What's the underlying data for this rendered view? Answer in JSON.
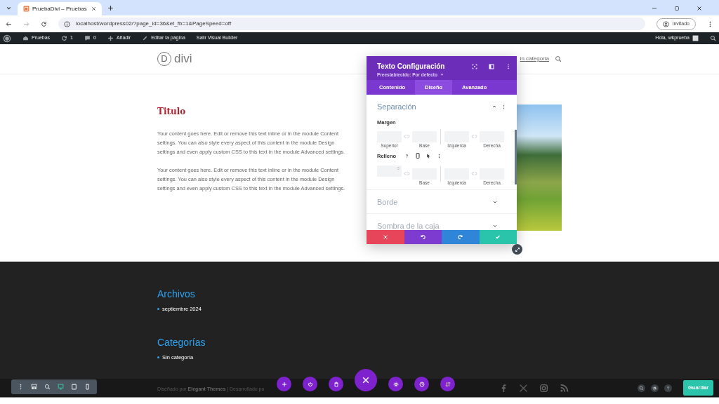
{
  "browser": {
    "tab_title": "PruebaDivi – Pruebas",
    "url": "localhost/wordpress02/?page_id=36&et_fb=1&PageSpeed=off",
    "profile": "Invitado"
  },
  "admin_bar": {
    "items": [
      {
        "kind": "site",
        "label": "Pruebas"
      },
      {
        "kind": "updates",
        "label": "1"
      },
      {
        "kind": "comments",
        "label": "0"
      },
      {
        "kind": "new",
        "label": "Añadir"
      },
      {
        "kind": "edit",
        "label": "Editar la página"
      },
      {
        "kind": "exit",
        "label": "Salir Visual Builder"
      }
    ],
    "greeting": "Hola, wkprueba"
  },
  "site": {
    "logo_letter": "D",
    "logo": "divi",
    "nav_item": "in categoria"
  },
  "content": {
    "title": "Titulo",
    "paragraphs": [
      "Your content goes here. Edit or remove this text inline or in the module Content settings. You can also style every aspect of this content in the module Design settings and even apply custom CSS to this text in the module Advanced settings.",
      "Your content goes here. Edit or remove this text inline or in the module Content settings. You can also style every aspect of this content in the module Design settings and even apply custom CSS to this text in the module Advanced settings."
    ]
  },
  "footer": {
    "widgets": [
      {
        "title": "Archivos",
        "items": [
          "septiembre 2024"
        ]
      },
      {
        "title": "Categorías",
        "items": [
          "Sin categoría"
        ]
      }
    ],
    "credits": "Diseñado por **Elegant Themes** | Desarrollado po"
  },
  "panel": {
    "title": "Texto Configuración",
    "preset": "Preestablecido: Por defecto",
    "tabs": [
      {
        "label": "Contenido",
        "selected": false
      },
      {
        "label": "Diseño",
        "selected": true
      },
      {
        "label": "Avanzado",
        "selected": false
      }
    ],
    "sections": [
      {
        "title": "Separación",
        "expanded": true,
        "groups": [
          {
            "label": "Margen",
            "fields": [
              {
                "label": "Superior"
              },
              {
                "label": "Base"
              },
              {
                "label": "Izquierda"
              },
              {
                "label": "Derecha"
              }
            ]
          },
          {
            "label": "Relleno",
            "tools": true,
            "fields": [
              {
                "spinner": true
              },
              {
                "label": "Base"
              },
              {
                "label": "Izquierda"
              },
              {
                "label": "Derecha"
              }
            ]
          }
        ]
      },
      {
        "title": "Borde",
        "expanded": false
      },
      {
        "title": "Sombra de la caja",
        "expanded": false
      }
    ],
    "actions": [
      {
        "kind": "cancel"
      },
      {
        "kind": "undo"
      },
      {
        "kind": "redo"
      },
      {
        "kind": "save"
      }
    ]
  },
  "builder": {
    "view_modes": [
      {
        "kind": "menu",
        "selected": false
      },
      {
        "kind": "layers",
        "selected": false
      },
      {
        "kind": "zoom",
        "selected": false
      },
      {
        "kind": "desktop",
        "selected": true
      },
      {
        "kind": "tablet",
        "selected": false
      },
      {
        "kind": "phone",
        "selected": false
      }
    ],
    "actions": [
      {
        "kind": "add"
      },
      {
        "kind": "power"
      },
      {
        "kind": "trash"
      },
      {
        "kind": "close"
      },
      {
        "kind": "settings"
      },
      {
        "kind": "history"
      },
      {
        "kind": "sort"
      }
    ],
    "tools": [
      {
        "kind": "search"
      },
      {
        "kind": "settings"
      },
      {
        "kind": "help"
      }
    ],
    "save": "Guardar"
  }
}
